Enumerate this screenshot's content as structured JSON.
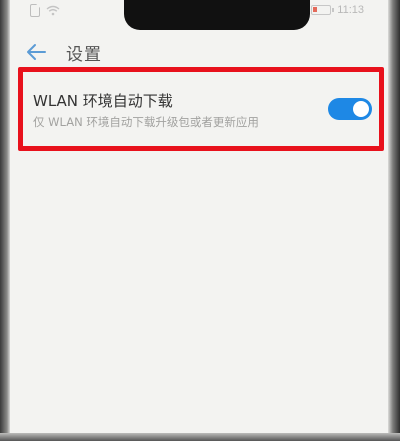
{
  "status_bar": {
    "time": "11:13"
  },
  "header": {
    "title": "设置",
    "back_icon": "arrow-left-icon"
  },
  "settings": {
    "wlan_auto_download": {
      "title": "WLAN 环境自动下载",
      "description": "仅 WLAN 环境自动下载升级包或者更新应用",
      "enabled": true
    }
  },
  "colors": {
    "toggle_on": "#1e88e5",
    "highlight_border": "#e8111c",
    "background": "#f3f3f1",
    "back_icon": "#5b9bd5"
  }
}
